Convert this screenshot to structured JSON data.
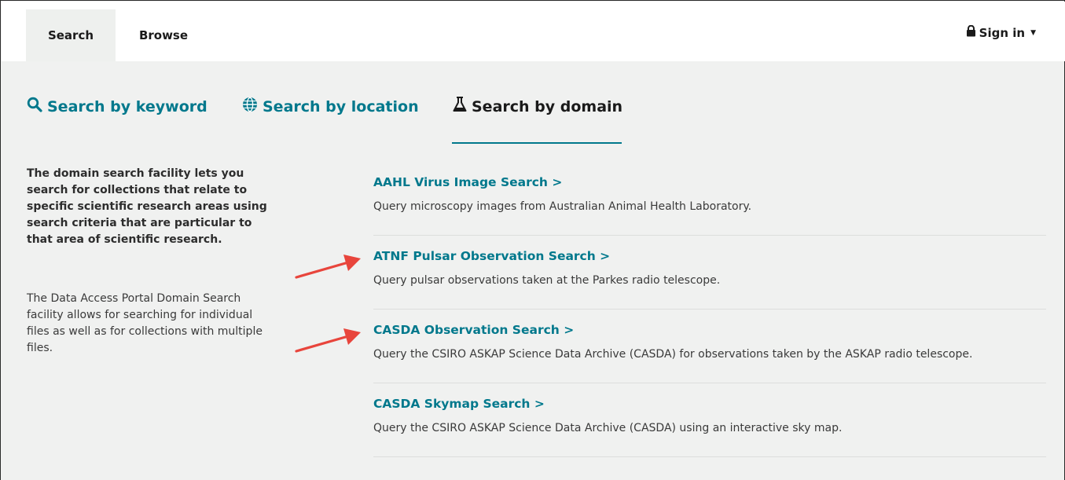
{
  "topnav": {
    "search": "Search",
    "browse": "Browse",
    "signin": "Sign in"
  },
  "search_tabs": {
    "keyword": "Search by keyword",
    "location": "Search by location",
    "domain": "Search by domain"
  },
  "intro": {
    "bold": "The domain search facility lets you search for collections that relate to specific scientific research areas using search criteria that are particular to that area of scientific research.",
    "plain": "The Data Access Portal Domain Search facility allows for searching for individual files as well as for collections with multiple files."
  },
  "results": [
    {
      "title": "AAHL Virus Image Search >",
      "desc": "Query microscopy images from Australian Animal Health Laboratory."
    },
    {
      "title": "ATNF Pulsar Observation Search >",
      "desc": "Query pulsar observations taken at the Parkes radio telescope."
    },
    {
      "title": "CASDA Observation Search >",
      "desc": "Query the CSIRO ASKAP Science Data Archive (CASDA) for observations taken by the ASKAP radio telescope."
    },
    {
      "title": "CASDA Skymap Search >",
      "desc": "Query the CSIRO ASKAP Science Data Archive (CASDA) using an interactive sky map."
    }
  ],
  "colors": {
    "accent": "#00788c",
    "annotation_arrow": "#e8453c",
    "page_bg": "#f0f1f0"
  }
}
